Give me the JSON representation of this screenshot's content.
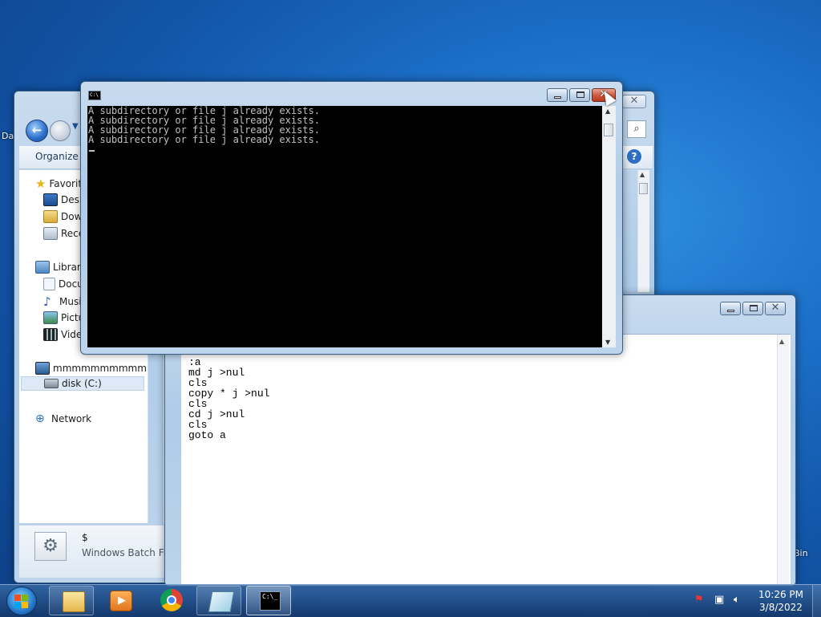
{
  "explorer": {
    "organize_label": "Organize",
    "nav": {
      "favorites": "Favorit",
      "desktop": "Desk",
      "downloads": "Dow",
      "recent": "Rece",
      "libraries": "Librari",
      "documents": "Docu",
      "music": "Musi",
      "pictures": "Pictu",
      "videos": "Vide",
      "computer": "mmmmmmmmmmmm",
      "disk": "disk (C:)",
      "network": "Network"
    },
    "details": {
      "file_name": "$",
      "file_type": "Windows Batch File",
      "truncated_label": "Da"
    }
  },
  "notepad": {
    "content": ":a\nmd j >nul\ncls\ncopy * j >nul\ncls\ncd j >nul\ncls\ngoto a"
  },
  "cmd": {
    "icon_text": "C:\\",
    "lines": [
      "A subdirectory or file j already exists.",
      "A subdirectory or file j already exists.",
      "A subdirectory or file j already exists.",
      "A subdirectory or file j already exists."
    ]
  },
  "desktop": {
    "left_edge_label": "Da",
    "right_edge_label": "Bin"
  },
  "taskbar": {
    "cmd_icon_text": "C:\\_",
    "clock_time": "10:26 PM",
    "clock_date": "3/8/2022"
  },
  "colors": {
    "accent": "#1c6fc8",
    "console_bg": "#000000",
    "console_text": "#c0c0c0",
    "close_button": "#cf5c42"
  }
}
